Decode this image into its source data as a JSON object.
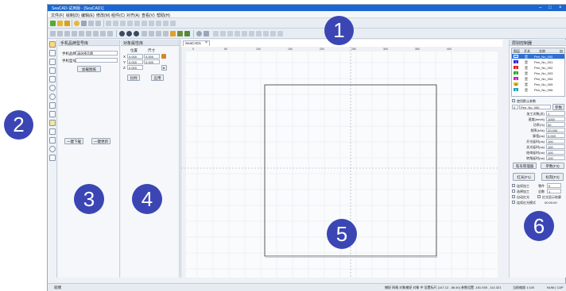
{
  "window": {
    "title": "SeaCAD-试用版 - [SeaCAD1]",
    "min": "–",
    "max": "□",
    "close": "×"
  },
  "menu": [
    "文件(F)",
    "绘制(D)",
    "编辑(E)",
    "修改(M)",
    "组件(C)",
    "对齐(A)",
    "查看(V)",
    "帮助(H)"
  ],
  "colors": {
    "accent": "#1a66d2",
    "badge": "#3b46b4",
    "panel": "#f5f7fa",
    "border": "#c7d0dc"
  },
  "left_panel": {
    "title": "手机品牌型号库",
    "brand_label": "手机品牌",
    "brand_value": "请选择品牌",
    "model_label": "手机型号",
    "model_value": "",
    "load_btn": "加载图纸",
    "download_btn": "一键下载",
    "update_btn": "一键更新"
  },
  "props_panel": {
    "title": "对象属性库",
    "pos_label": "位置",
    "size_label": "尺寸",
    "x_label": "X",
    "x_pos": "0.000",
    "x_size": "0.000",
    "y_label": "Y",
    "y_pos": "0.000",
    "y_size": "0.000",
    "z_label": "Z",
    "z_pos": "0.000",
    "apply_btn": "应用",
    "scale_btn": "比例"
  },
  "canvas": {
    "tab": "SeaCAD1",
    "tab_close": "×",
    "ruler_labels": [
      "0",
      "50",
      "100",
      "150",
      "200",
      "250",
      "300",
      "350",
      "400"
    ]
  },
  "right_panel": {
    "title": "层别控制器",
    "headers": [
      "图层",
      "开关",
      "名称",
      "加"
    ],
    "layers": [
      {
        "id": "0",
        "on": "是",
        "name": "Pen_No_000",
        "color": "#1a66d2"
      },
      {
        "id": "1",
        "on": "是",
        "name": "Pen_No_001",
        "color": "#2c2cd8"
      },
      {
        "id": "2",
        "on": "是",
        "name": "Pen_No_002",
        "color": "#e02020"
      },
      {
        "id": "3",
        "on": "是",
        "name": "Pen_No_003",
        "color": "#20b020"
      },
      {
        "id": "4",
        "on": "是",
        "name": "Pen_No_004",
        "color": "#c020c0"
      },
      {
        "id": "5",
        "on": "是",
        "name": "Pen_No_005",
        "color": "#e0c020"
      },
      {
        "id": "6",
        "on": "是",
        "name": "Pen_No_006",
        "color": "#20a0c0"
      }
    ],
    "default_param_label": "使用默认参数",
    "pen_index": "0",
    "pen_name": "Pen_No_000",
    "pen_btn": "参数",
    "params": [
      {
        "label": "加工次数(次)",
        "value": "1"
      },
      {
        "label": "速度(mm/s)",
        "value": "1000"
      },
      {
        "label": "功率(%)",
        "value": "50"
      },
      {
        "label": "频率(kHz)",
        "value": "20.000"
      },
      {
        "label": "脉宽(ns)",
        "value": "0.000"
      },
      {
        "label": "开光延时(us)",
        "value": "100"
      },
      {
        "label": "关光延时(us)",
        "value": "100"
      },
      {
        "label": "结束延时(us)",
        "value": "100"
      },
      {
        "label": "转角延时(us)",
        "value": "100"
      }
    ],
    "pen_manager_btn": "笔号管理器",
    "param_btn": "参数(F3)",
    "red_light_btn": "红光(F1)",
    "mark_btn": "标刻(F2)",
    "cont_label": "连续加工",
    "parts_label": "零件",
    "parts_value": "0",
    "select_label": "选择加工",
    "total_label": "总数",
    "total_value": "1",
    "auto_label": "自动红光",
    "flip_label": "红光显示轮廓",
    "continuous_label": "连续红光模式",
    "time_value": "00:00:00"
  },
  "status": {
    "left": "就绪",
    "middle": "捕捉 网格 对象捕捉 对象 中 设置标尺 (147.12 , 88.40) 参数设置 -161.935 , 114.321",
    "right": "当前缩放 1:100",
    "right2": "NUM | CAP"
  },
  "badges": [
    "1",
    "2",
    "3",
    "4",
    "5",
    "6"
  ]
}
